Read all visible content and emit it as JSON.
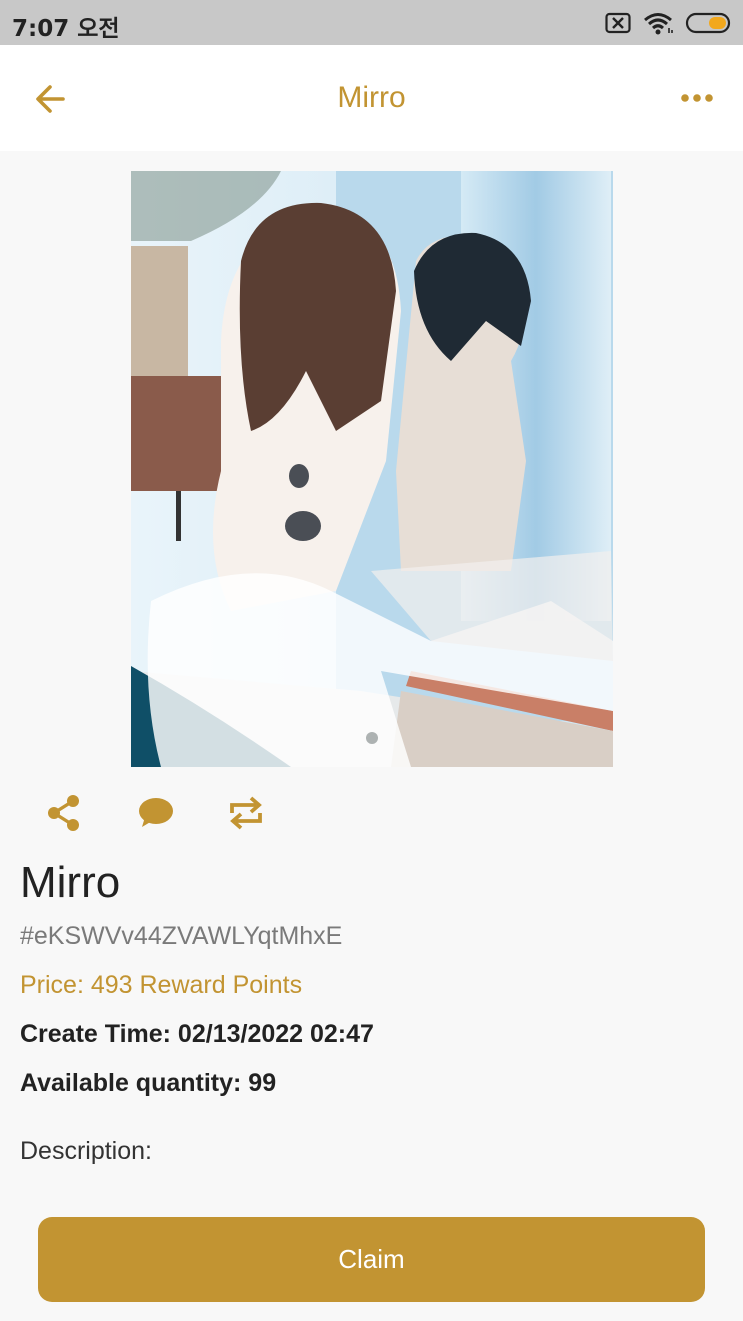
{
  "status_bar": {
    "time": "7:07 오전",
    "icons": [
      "sim-error-icon",
      "wifi-icon",
      "battery-icon"
    ]
  },
  "app_bar": {
    "title": "Mirro",
    "back_icon": "arrow-left-icon",
    "more_icon": "more-horizontal-icon"
  },
  "actions": [
    {
      "icon": "share-icon"
    },
    {
      "icon": "comment-icon"
    },
    {
      "icon": "repost-icon"
    }
  ],
  "item": {
    "name": "Mirro",
    "id": "#eKSWVv44ZVAWLYqtMhxE",
    "price": "Price: 493 Reward Points",
    "create_time": "Create Time: 02/13/2022 02:47",
    "available_quantity": "Available quantity: 99",
    "description_label": "Description:"
  },
  "claim_button": {
    "label": "Claim"
  },
  "colors": {
    "accent": "#c29432",
    "status_bar": "#c8c8c8",
    "background": "#f8f8f8"
  }
}
